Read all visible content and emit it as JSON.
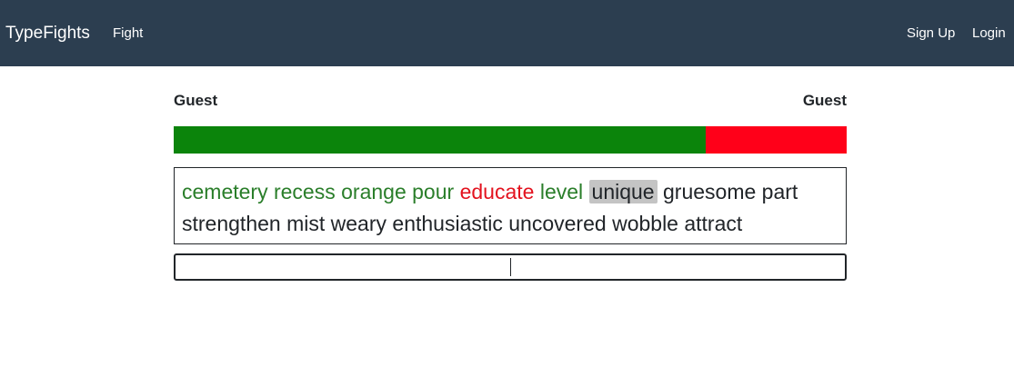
{
  "navbar": {
    "brand": "TypeFights",
    "links": {
      "fight": "Fight",
      "signup": "Sign Up",
      "login": "Login"
    },
    "background_color": "#2c3e50"
  },
  "race": {
    "left_player": "Guest",
    "right_player": "Guest",
    "progress_fraction": 0.79,
    "progress_color": "#0b840b",
    "remaining_color": "#ff0019"
  },
  "passage": {
    "words": [
      {
        "text": "cemetery",
        "state": "correct"
      },
      {
        "text": "recess",
        "state": "correct"
      },
      {
        "text": "orange",
        "state": "correct"
      },
      {
        "text": "pour",
        "state": "correct"
      },
      {
        "text": "educate",
        "state": "wrong"
      },
      {
        "text": "level",
        "state": "correct"
      },
      {
        "text": "unique",
        "state": "current"
      },
      {
        "text": "gruesome",
        "state": "pending"
      },
      {
        "text": "part",
        "state": "pending"
      },
      {
        "text": "strengthen",
        "state": "pending"
      },
      {
        "text": "mist",
        "state": "pending"
      },
      {
        "text": "weary",
        "state": "pending"
      },
      {
        "text": "enthusiastic",
        "state": "pending"
      },
      {
        "text": "uncovered",
        "state": "pending"
      },
      {
        "text": "wobble",
        "state": "pending"
      },
      {
        "text": "attract",
        "state": "pending"
      }
    ]
  },
  "input": {
    "value": ""
  }
}
